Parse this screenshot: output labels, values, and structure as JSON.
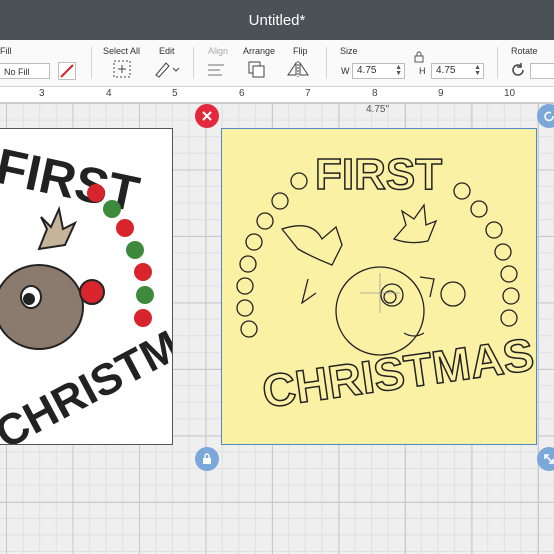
{
  "window": {
    "title": "Untitled*"
  },
  "toolbar": {
    "fill_label": "Fill",
    "fill_value": "No Fill",
    "select_all_label": "Select All",
    "edit_label": "Edit",
    "align_label": "Align",
    "arrange_label": "Arrange",
    "flip_label": "Flip",
    "size_label": "Size",
    "width_label": "W",
    "width_value": "4.75",
    "height_label": "H",
    "height_value": "4.75",
    "rotate_label": "Rotate"
  },
  "ruler": {
    "ticks": [
      "3",
      "4",
      "5",
      "6",
      "7",
      "8",
      "9",
      "10"
    ]
  },
  "canvas": {
    "width_readout": "4.75\"",
    "design_text_top": "FIRST",
    "design_text_bottom": "CHRISTMAS"
  },
  "colors": {
    "titlebar": "#4a5157",
    "selection_fill": "#fbf1a4",
    "selection_border": "#4d8ac9",
    "delete_handle": "#e2283a",
    "handle_blue": "#7ba7d9",
    "dot_red": "#d8242c",
    "dot_green": "#3d8a3c",
    "reindeer_brown": "#8b7a6e",
    "antler_tan": "#c6b49a"
  },
  "icons": {
    "delete": "close-icon",
    "lock": "lock-icon",
    "rotate_handle": "rotate-icon",
    "resize_handle": "resize-icon"
  }
}
